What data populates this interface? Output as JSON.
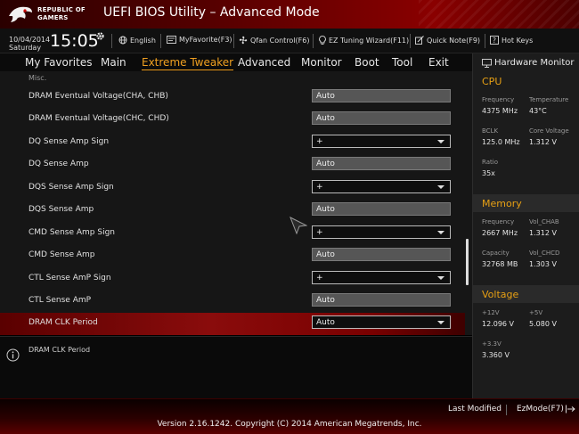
{
  "header": {
    "brand_line1": "REPUBLIC OF",
    "brand_line2": "GAMERS",
    "title": "UEFI BIOS Utility – Advanced Mode"
  },
  "toolbar": {
    "date": "10/04/2014",
    "day": "Saturday",
    "time": "15:05",
    "items": [
      {
        "label": "English",
        "icon": "globe-icon"
      },
      {
        "label": "MyFavorite(F3)",
        "icon": "favorite-icon"
      },
      {
        "label": "Qfan Control(F6)",
        "icon": "fan-icon"
      },
      {
        "label": "EZ Tuning Wizard(F11)",
        "icon": "lightbulb-icon"
      },
      {
        "label": "Quick Note(F9)",
        "icon": "note-icon"
      },
      {
        "label": "Hot Keys",
        "icon": "help-icon"
      }
    ]
  },
  "tabs": [
    "My Favorites",
    "Main",
    "Extreme Tweaker",
    "Advanced",
    "Monitor",
    "Boot",
    "Tool",
    "Exit"
  ],
  "active_tab": "Extreme Tweaker",
  "main": {
    "section": "Misc.",
    "rows": [
      {
        "label": "DRAM Eventual Voltage(CHA, CHB)",
        "value": "Auto",
        "type": "text"
      },
      {
        "label": "DRAM Eventual Voltage(CHC, CHD)",
        "value": "Auto",
        "type": "text"
      },
      {
        "label": "DQ Sense Amp Sign",
        "value": "+",
        "type": "dropdown"
      },
      {
        "label": "DQ Sense Amp",
        "value": "Auto",
        "type": "text"
      },
      {
        "label": "DQS Sense Amp Sign",
        "value": "+",
        "type": "dropdown"
      },
      {
        "label": "DQS Sense Amp",
        "value": "Auto",
        "type": "text"
      },
      {
        "label": "CMD Sense Amp Sign",
        "value": "+",
        "type": "dropdown"
      },
      {
        "label": "CMD Sense Amp",
        "value": "Auto",
        "type": "text"
      },
      {
        "label": "CTL Sense AmP Sign",
        "value": "+",
        "type": "dropdown"
      },
      {
        "label": "CTL Sense AmP",
        "value": "Auto",
        "type": "text"
      },
      {
        "label": "DRAM CLK Period",
        "value": "Auto",
        "type": "dropdown",
        "selected": true
      }
    ]
  },
  "help": {
    "text": "DRAM CLK Period"
  },
  "hw": {
    "title": "Hardware Monitor",
    "cpu": {
      "title": "CPU",
      "frequency_label": "Frequency",
      "frequency": "4375 MHz",
      "temperature_label": "Temperature",
      "temperature": "43°C",
      "bclk_label": "BCLK",
      "bclk": "125.0 MHz",
      "core_voltage_label": "Core Voltage",
      "core_voltage": "1.312 V",
      "ratio_label": "Ratio",
      "ratio": "35x"
    },
    "memory": {
      "title": "Memory",
      "frequency_label": "Frequency",
      "frequency": "2667 MHz",
      "vol_chab_label": "Vol_CHAB",
      "vol_chab": "1.312 V",
      "capacity_label": "Capacity",
      "capacity": "32768 MB",
      "vol_chcd_label": "Vol_CHCD",
      "vol_chcd": "1.303 V"
    },
    "voltage": {
      "title": "Voltage",
      "v12_label": "+12V",
      "v12": "12.096 V",
      "v5_label": "+5V",
      "v5": "5.080 V",
      "v33_label": "+3.3V",
      "v33": "3.360 V"
    }
  },
  "footer": {
    "last_modified": "Last Modified",
    "ezmode": "EzMode(F7)",
    "copyright": "Version 2.16.1242. Copyright (C) 2014 American Megatrends, Inc."
  },
  "colors": {
    "accent": "#f0a020",
    "selection": "#8a0c0c",
    "header_red": "#8a0000"
  }
}
